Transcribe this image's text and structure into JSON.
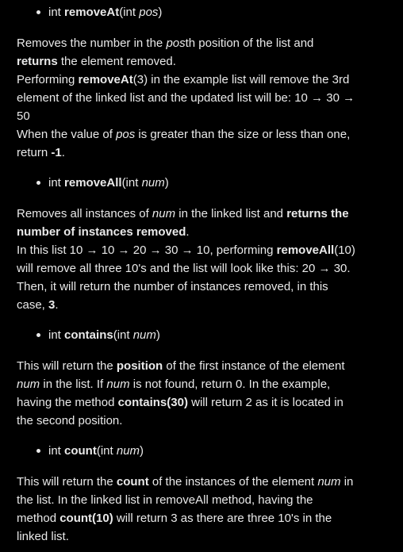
{
  "sections": {
    "removeAt": {
      "sig": {
        "type": "int ",
        "name": "removeAt",
        "open": "(int ",
        "param": "pos",
        "close": ")"
      },
      "para": {
        "l1a": "Removes the number in the ",
        "l1b": "pos",
        "l1c": "th position of the list and",
        "l2a": "returns",
        "l2b": " the element removed.",
        "l3a": "Performing ",
        "l3b": "removeAt",
        "l3c": "(3) in the example list will remove the 3rd",
        "l4": "element of the linked list and the updated list will be: 10 → 30 →",
        "l5": "50",
        "l6a": "When the value of ",
        "l6b": "pos",
        "l6c": " is greater than the size or less than one,",
        "l7a": "return ",
        "l7b": "-1",
        "l7c": "."
      }
    },
    "removeAll": {
      "sig": {
        "type": "int ",
        "name": "removeAll",
        "open": "(int ",
        "param": "num",
        "close": ")"
      },
      "para": {
        "l1a": "Removes all instances of ",
        "l1b": "num",
        "l1c": " in the linked list and ",
        "l1d": "returns the",
        "l2a": "number of instances removed",
        "l2b": ".",
        "l3a": "In this list 10 → 10 → 20 → 30 → 10, performing ",
        "l3b": "removeAll",
        "l3c": "(10)",
        "l4": "will remove all three 10's and the list will look like this: 20 → 30.",
        "l5": "Then, it will return the number of instances removed, in this",
        "l6a": "case, ",
        "l6b": "3",
        "l6c": "."
      }
    },
    "contains": {
      "sig": {
        "type": "int ",
        "name": "contains",
        "open": "(int ",
        "param": "num",
        "close": ")"
      },
      "para": {
        "l1a": "This will return the ",
        "l1b": "position",
        "l1c": " of the first instance of the element",
        "l2a": "num",
        "l2b": " in the list. If ",
        "l2c": "num",
        "l2d": " is not found, return 0. In the example,",
        "l3a": "having the method ",
        "l3b": "contains(30)",
        "l3c": " will return 2 as it is located in",
        "l4": "the second position."
      }
    },
    "count": {
      "sig": {
        "type": "int ",
        "name": "count",
        "open": "(int ",
        "param": "num",
        "close": ")"
      },
      "para": {
        "l1a": "This will return the ",
        "l1b": "count",
        "l1c": " of the instances of the element ",
        "l1d": "num",
        "l1e": " in",
        "l2": "the list. In the linked list in removeAll method, having the",
        "l3a": "method ",
        "l3b": "count(10)",
        "l3c": " will return 3 as there are three 10's in the",
        "l4": "linked list."
      }
    }
  }
}
